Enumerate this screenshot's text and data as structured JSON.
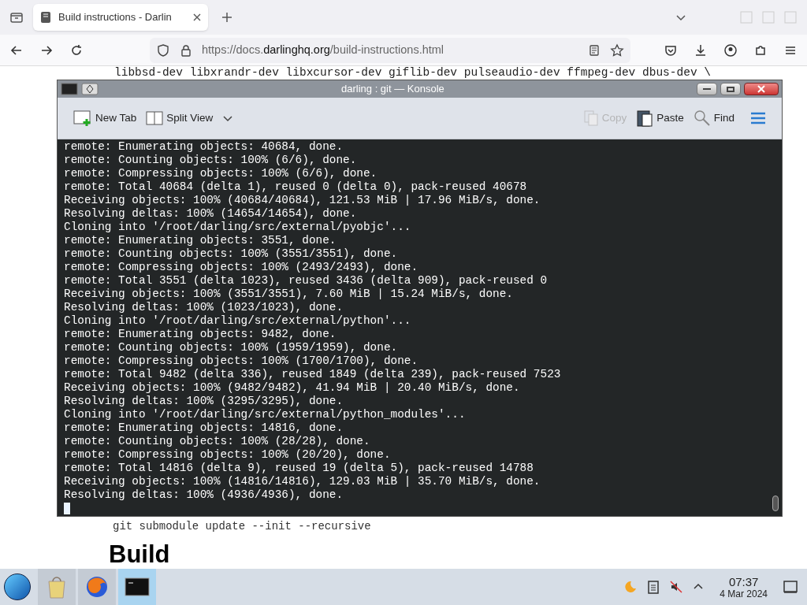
{
  "browser": {
    "tab": {
      "title": "Build instructions - Darlin",
      "selected": true
    },
    "url": {
      "scheme_host": "https://docs.",
      "domain": "darlinghq.org",
      "path": "/build-instructions.html"
    }
  },
  "page": {
    "code_lines": [
      "libbsd-dev libxrandr-dev libxcursor-dev giflib-dev pulseaudio-dev ffmpeg-dev dbus-dev \\",
      "git submodule update --init --recursive"
    ],
    "heading": "Build"
  },
  "konsole": {
    "title": "darling : git — Konsole",
    "toolbar": [
      {
        "kind": "new-tab",
        "label": "New Tab",
        "disabled": false
      },
      {
        "kind": "split-view",
        "label": "Split View",
        "disabled": false
      },
      {
        "kind": "copy",
        "label": "Copy",
        "disabled": true
      },
      {
        "kind": "paste",
        "label": "Paste",
        "disabled": false
      },
      {
        "kind": "find",
        "label": "Find",
        "disabled": false
      }
    ],
    "lines": [
      "remote: Enumerating objects: 40684, done.",
      "remote: Counting objects: 100% (6/6), done.",
      "remote: Compressing objects: 100% (6/6), done.",
      "remote: Total 40684 (delta 1), reused 0 (delta 0), pack-reused 40678",
      "Receiving objects: 100% (40684/40684), 121.53 MiB | 17.96 MiB/s, done.",
      "Resolving deltas: 100% (14654/14654), done.",
      "Cloning into '/root/darling/src/external/pyobjc'...",
      "remote: Enumerating objects: 3551, done.",
      "remote: Counting objects: 100% (3551/3551), done.",
      "remote: Compressing objects: 100% (2493/2493), done.",
      "remote: Total 3551 (delta 1023), reused 3436 (delta 909), pack-reused 0",
      "Receiving objects: 100% (3551/3551), 7.60 MiB | 15.24 MiB/s, done.",
      "Resolving deltas: 100% (1023/1023), done.",
      "Cloning into '/root/darling/src/external/python'...",
      "remote: Enumerating objects: 9482, done.",
      "remote: Counting objects: 100% (1959/1959), done.",
      "remote: Compressing objects: 100% (1700/1700), done.",
      "remote: Total 9482 (delta 336), reused 1849 (delta 239), pack-reused 7523",
      "Receiving objects: 100% (9482/9482), 41.94 MiB | 20.40 MiB/s, done.",
      "Resolving deltas: 100% (3295/3295), done.",
      "Cloning into '/root/darling/src/external/python_modules'...",
      "remote: Enumerating objects: 14816, done.",
      "remote: Counting objects: 100% (28/28), done.",
      "remote: Compressing objects: 100% (20/20), done.",
      "remote: Total 14816 (delta 9), reused 19 (delta 5), pack-reused 14788",
      "Receiving objects: 100% (14816/14816), 129.03 MiB | 35.70 MiB/s, done.",
      "Resolving deltas: 100% (4936/4936), done."
    ]
  },
  "taskbar": {
    "apps": [
      {
        "kind": "files",
        "selected": false
      },
      {
        "kind": "browser",
        "selected": false
      },
      {
        "kind": "terminal",
        "selected": true
      }
    ],
    "clock": {
      "time": "07:37",
      "date": "4 Mar 2024"
    }
  }
}
